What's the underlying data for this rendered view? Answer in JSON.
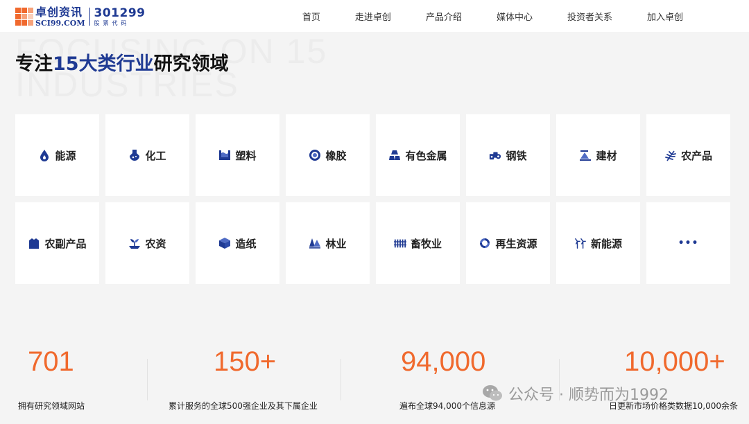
{
  "header": {
    "logo_cn": "卓创资讯",
    "logo_en": "SCI99.COM",
    "stock_code": "301299",
    "stock_label": "股票代码",
    "nav": [
      "首页",
      "走进卓创",
      "产品介绍",
      "媒体中心",
      "投资者关系",
      "加入卓创"
    ]
  },
  "hero": {
    "bg_text": "FOCUSING ON 15\nINDUSTRIES",
    "title_pre": "专注",
    "title_hl": "15大类行业",
    "title_post": "研究领域"
  },
  "industries": [
    {
      "label": "能源",
      "icon": "drop-icon"
    },
    {
      "label": "化工",
      "icon": "flask-icon"
    },
    {
      "label": "塑料",
      "icon": "plastic-icon"
    },
    {
      "label": "橡胶",
      "icon": "tire-icon"
    },
    {
      "label": "有色金属",
      "icon": "ingot-icon"
    },
    {
      "label": "钢铁",
      "icon": "steel-icon"
    },
    {
      "label": "建材",
      "icon": "building-icon"
    },
    {
      "label": "农产品",
      "icon": "wheat-icon"
    },
    {
      "label": "农副产品",
      "icon": "bag-icon"
    },
    {
      "label": "农资",
      "icon": "seedling-icon"
    },
    {
      "label": "造纸",
      "icon": "box-icon"
    },
    {
      "label": "林业",
      "icon": "trees-icon"
    },
    {
      "label": "畜牧业",
      "icon": "fence-icon"
    },
    {
      "label": "再生资源",
      "icon": "recycle-icon"
    },
    {
      "label": "新能源",
      "icon": "wind-turbine-icon"
    },
    {
      "label": "•••",
      "icon": "more-icon"
    }
  ],
  "stats": [
    {
      "value": "701",
      "desc": "拥有研究领域网站"
    },
    {
      "value": "150+",
      "desc": "累计服务的全球500强企业及其下属企业"
    },
    {
      "value": "94,000",
      "desc": "遍布全球94,000个信息源"
    },
    {
      "value": "10,000+",
      "desc": "日更新市场价格类数据10,000余条"
    }
  ],
  "watermark": {
    "text": "公众号 · 顺势而为1992"
  },
  "colors": {
    "brand_blue": "#1f3a93",
    "accent_orange": "#f0692d"
  }
}
